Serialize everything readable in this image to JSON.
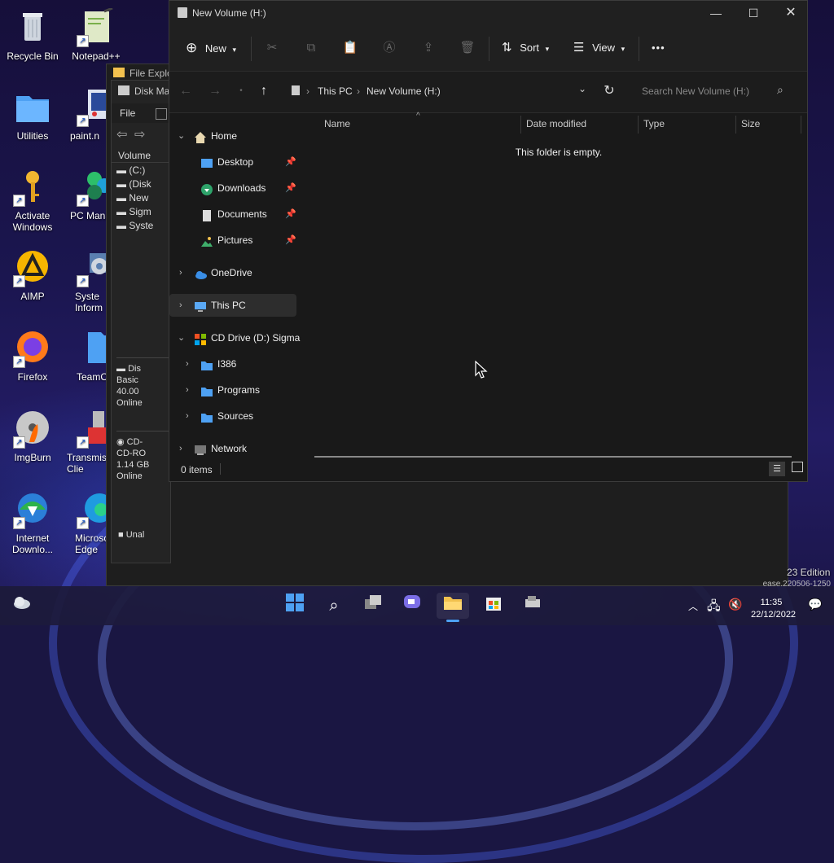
{
  "desktop": {
    "icons": [
      {
        "label": "Recycle Bin"
      },
      {
        "label": "Notepad++"
      },
      {
        "label": "Utilities"
      },
      {
        "label": "paint.n"
      },
      {
        "label": "Activate Windows"
      },
      {
        "label": "PC Mana"
      },
      {
        "label": "AIMP"
      },
      {
        "label": "Syste Inform"
      },
      {
        "label": "Firefox"
      },
      {
        "label": "TeamO"
      },
      {
        "label": "ImgBurn"
      },
      {
        "label": "Transmis Qt Clie"
      },
      {
        "label": "Internet Downlo..."
      },
      {
        "label": "Microso Edge"
      }
    ],
    "watermark_line1": "23 Edition",
    "watermark_line2": "ease.220506-1250"
  },
  "bg_windows": {
    "file_explorer_title": "File Explo",
    "disk_mgmt_title": "Disk Ma",
    "menu_file": "File",
    "volume_header": "Volume",
    "volumes": [
      "(C:)",
      "(Disk",
      "New",
      "Sigm",
      "Syste"
    ],
    "disk0": {
      "name": "Dis",
      "type": "Basic",
      "size": "40.00",
      "status": "Online"
    },
    "disk1": {
      "name": "CD-",
      "type": "CD-RO",
      "size": "1.14 GB",
      "status": "Online"
    },
    "unallocated": "Unal"
  },
  "explorer": {
    "title": "New Volume (H:)",
    "toolbar": {
      "new_label": "New",
      "sort_label": "Sort",
      "view_label": "View",
      "more_label": "•••"
    },
    "address": {
      "crumb1": "This PC",
      "crumb2": "New Volume (H:)"
    },
    "search_placeholder": "Search New Volume (H:)",
    "nav": {
      "home": "Home",
      "desktop": "Desktop",
      "downloads": "Downloads",
      "documents": "Documents",
      "pictures": "Pictures",
      "onedrive": "OneDrive",
      "thispc": "This PC",
      "cddrive": "CD Drive (D:) Sigma",
      "i386": "I386",
      "programs": "Programs",
      "sources": "Sources",
      "network": "Network"
    },
    "columns": {
      "name": "Name",
      "date": "Date modified",
      "type": "Type",
      "size": "Size"
    },
    "empty_message": "This folder is empty.",
    "status": "0 items"
  },
  "taskbar": {
    "time": "11:35",
    "date": "22/12/2022"
  },
  "colors": {
    "accent": "#4ea1f3",
    "folder": "#f2c14e",
    "selection": "#2d2d2d"
  }
}
